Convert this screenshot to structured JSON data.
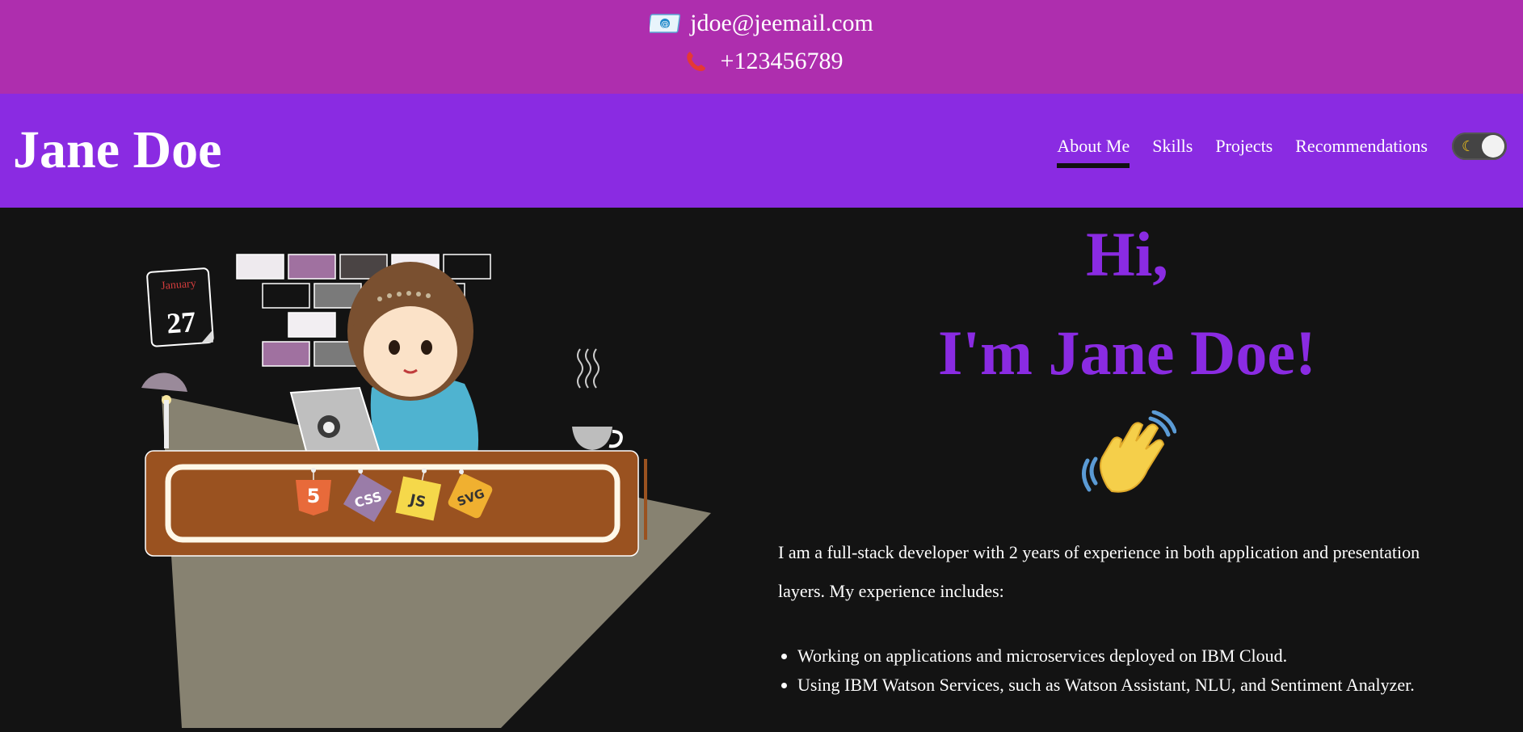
{
  "contact": {
    "email": "jdoe@jeemail.com",
    "phone": "+123456789",
    "email_icon": "envelope-icon",
    "phone_icon": "phone-icon"
  },
  "header": {
    "title": "Jane Doe",
    "nav": [
      {
        "label": "About Me",
        "active": true
      },
      {
        "label": "Skills",
        "active": false
      },
      {
        "label": "Projects",
        "active": false
      },
      {
        "label": "Recommendations",
        "active": false
      }
    ],
    "theme_toggle_icon": "moon-icon"
  },
  "illustration": {
    "calendar_month": "January",
    "calendar_day": "27",
    "badges": [
      "5",
      "CSS",
      "JS",
      "SVG"
    ]
  },
  "hero": {
    "greeting_line1": "Hi,",
    "greeting_line2": "I'm Jane Doe!",
    "wave_icon": "waving-hand-icon",
    "intro": "I am a full-stack developer with 2 years of experience in both application and presentation layers. My experience includes:",
    "bullets": [
      "Working on applications and microservices deployed on IBM Cloud.",
      "Using IBM Watson Services, such as Watson Assistant, NLU, and Sentiment Analyzer."
    ]
  },
  "colors": {
    "contact_bg": "#ae2eae",
    "header_bg": "#8a2be2",
    "page_bg": "#131313",
    "accent": "#8a2be2"
  }
}
